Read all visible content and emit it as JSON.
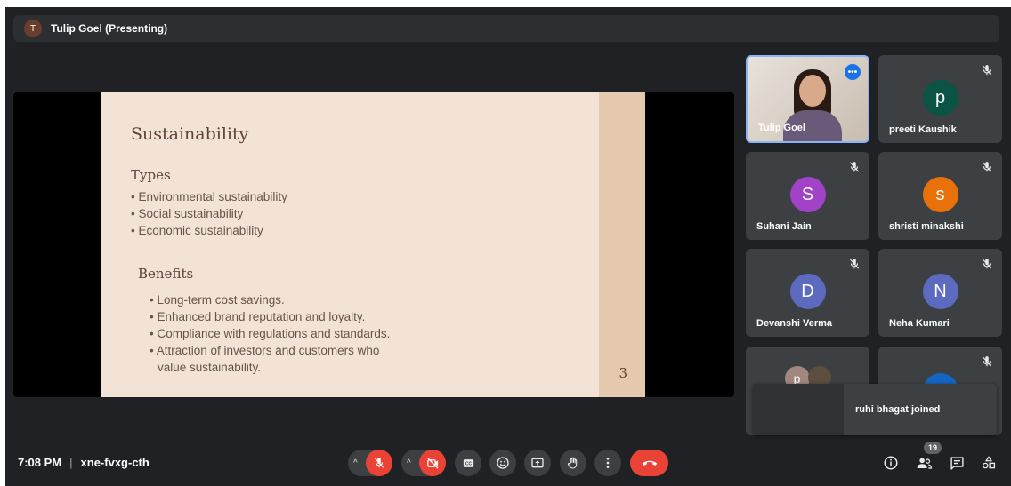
{
  "presenter": {
    "avatar_letter": "T",
    "label": "Tulip Goel (Presenting)"
  },
  "slide": {
    "title": "Sustainability",
    "section1": "Types",
    "types": [
      "Environmental sustainability",
      "Social sustainability",
      "Economic sustainability"
    ],
    "section2": "Benefits",
    "benefits": [
      "Long-term cost savings.",
      "Enhanced brand reputation and loyalty.",
      "Compliance with regulations and standards.",
      "Attraction of investors and customers who"
    ],
    "benefits_continued": "value sustainability.",
    "page_number": "3"
  },
  "participants": [
    {
      "name": "Tulip Goel",
      "avatar": "",
      "color": "",
      "camera_on": true,
      "muted": false
    },
    {
      "name": "preeti Kaushik",
      "avatar": "p",
      "color": "#0b5345",
      "muted": true
    },
    {
      "name": "Suhani Jain",
      "avatar": "S",
      "color": "#a142c8",
      "muted": true
    },
    {
      "name": "shristi minakshi",
      "avatar": "s",
      "color": "#e8710a",
      "muted": true
    },
    {
      "name": "Devanshi Verma",
      "avatar": "D",
      "color": "#5c6bc0",
      "muted": true
    },
    {
      "name": "Neha Kumari",
      "avatar": "N",
      "color": "#5c6bc0",
      "muted": true
    },
    {
      "name": "",
      "avatar": "p",
      "color": "#a1887f",
      "muted": false
    },
    {
      "name": "",
      "avatar": "",
      "color": "#1565c0",
      "muted": true
    }
  ],
  "toast": {
    "text": "ruhi bhagat joined"
  },
  "meeting": {
    "time": "7:08 PM",
    "code": "xne-fvxg-cth",
    "participant_count": "19"
  }
}
